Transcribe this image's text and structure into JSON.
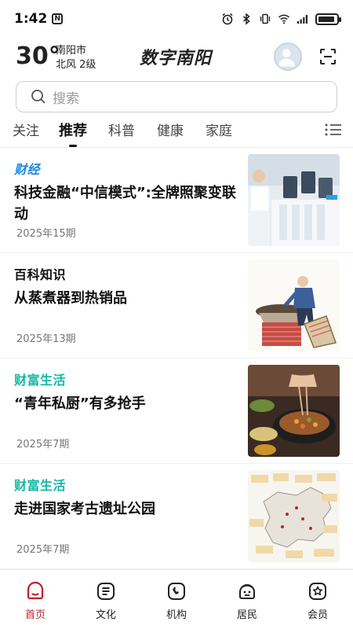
{
  "status_bar": {
    "time": "1:42",
    "notification_badge": "N",
    "battery_level": 0.9
  },
  "header": {
    "temperature": "30°",
    "city": "南阳市",
    "wind": "北风  2级",
    "logo": "数字南阳"
  },
  "search": {
    "placeholder": "搜索"
  },
  "tabs": [
    {
      "label": "关注"
    },
    {
      "label": "推荐",
      "active": true
    },
    {
      "label": "科普"
    },
    {
      "label": "健康"
    },
    {
      "label": "家庭"
    }
  ],
  "feed": [
    {
      "tag": "财经",
      "tag_color": "#1e88e5",
      "title": "科技金融“中信模式”:全牌照聚变联动",
      "date": "2025年15期",
      "thumb": "lab"
    },
    {
      "tag": "百科知识",
      "tag_color": "#111111",
      "title": "从蒸煮器到热销品",
      "date": "2025年13期",
      "thumb": "cooking-illustration"
    },
    {
      "tag": "财富生活",
      "tag_color": "#14b8a6",
      "title": "“青年私厨”有多抢手",
      "date": "2025年7期",
      "thumb": "wok"
    },
    {
      "tag": "财富生活",
      "tag_color": "#14b8a6",
      "title": "走进国家考古遗址公园",
      "date": "2025年7期",
      "thumb": "map"
    }
  ],
  "bottom_nav": [
    {
      "label": "首页",
      "icon": "home-icon",
      "active": true
    },
    {
      "label": "文化",
      "icon": "culture-icon"
    },
    {
      "label": "机构",
      "icon": "institution-icon"
    },
    {
      "label": "居民",
      "icon": "resident-icon"
    },
    {
      "label": "会员",
      "icon": "member-icon"
    }
  ],
  "colors": {
    "accent": "#c0222a",
    "tag_blue": "#1e88e5",
    "tag_teal": "#14b8a6"
  }
}
